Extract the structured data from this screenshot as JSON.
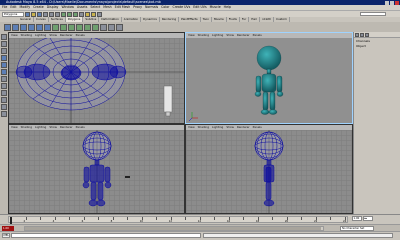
{
  "app": {
    "window_title": "Autodesk Maya 8.5 x64 - D:\\Users\\Maelle\\Documents\\maya\\projects\\default\\scenes\\bot.mb"
  },
  "menubar": {
    "items": [
      "File",
      "Edit",
      "Modify",
      "Create",
      "Display",
      "Window",
      "Assets",
      "Select",
      "Mesh",
      "Edit Mesh",
      "Proxy",
      "Normals",
      "Color",
      "Create UVs",
      "Edit UVs",
      "Muscle",
      "Help"
    ]
  },
  "statusline": {
    "mode_value": "Polygons"
  },
  "shelf": {
    "tabs": [
      "General",
      "Curves",
      "Surfaces",
      "Polygons",
      "Subdivs",
      "Deformation",
      "Animation",
      "Dynamics",
      "Rendering",
      "PaintEffects",
      "Toon",
      "Muscle",
      "Fluids",
      "Fur",
      "Hair",
      "nCloth",
      "Custom"
    ],
    "active_tab": "Polygons"
  },
  "viewports": {
    "menu": [
      "View",
      "Shading",
      "Lighting",
      "Show",
      "Renderer",
      "Panels"
    ]
  },
  "channel_box": {
    "title": "Channels",
    "subtitle": "Object"
  },
  "time_slider": {
    "start": "1",
    "end": "24",
    "current": "1.00",
    "tick_labels": [
      "2",
      "4",
      "6",
      "8",
      "10",
      "12",
      "14",
      "16",
      "18",
      "20",
      "22",
      "24"
    ]
  },
  "range_slider": {
    "start_value": "1.00",
    "character_set": "No Character Set"
  },
  "command_line": {
    "language": "MEL"
  },
  "colors": {
    "wireframe_blue": "#0a0aa0",
    "model_teal": "#1f7f86",
    "title_bar": "#0b246b",
    "active_viewport_border": "#9fd3ff"
  },
  "icons": [
    "maya-logo",
    "select-tool",
    "lasso-tool",
    "move-tool",
    "rotate-tool",
    "scale-tool",
    "render-icon"
  ]
}
